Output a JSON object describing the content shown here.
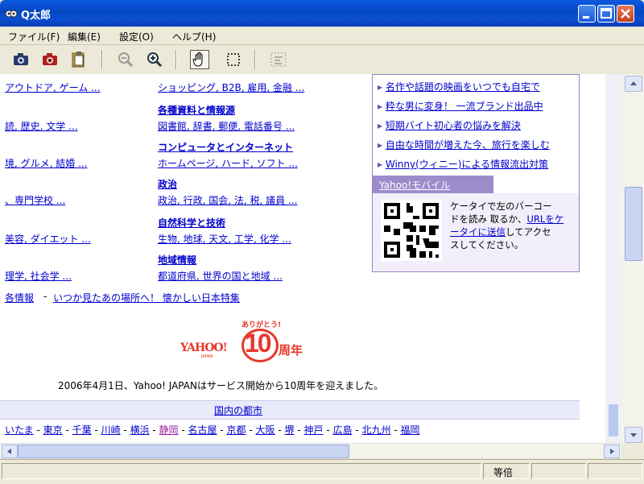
{
  "window": {
    "title": "Q太郎"
  },
  "menu": {
    "file": "ファイル(F)",
    "edit": "編集(E)",
    "settings": "設定(O)",
    "help": "ヘルプ(H)"
  },
  "colors": {
    "link": "#0000cc",
    "panel_header": "#9c8ccc",
    "logo_red": "#e8382c",
    "titlebar": "#0646c2"
  },
  "left_links": {
    "row1": "アウトドア, ゲーム ...",
    "row2": "読, 歴史, 文学 ...",
    "row3": "境, グルメ, 結婚 ...",
    "row4": "、専門学校 ...",
    "row5": "美容, ダイエット ...",
    "row6": "理学, 社会学 ..."
  },
  "directory": {
    "shopping": "ショッピング, B2B, 雇用, 金融 ...",
    "reference_title": "各種資料と情報源",
    "reference_links": "図書館, 辞書, 郵便, 電話番号 ...",
    "computer_title": "コンピュータとインターネット",
    "computer_links": "ホームページ, ハード, ソフト ...",
    "politics_title": "政治",
    "politics_links": "政治, 行政, 国会, 法, 税, 議員 ...",
    "science_title": "自然科学と技術",
    "science_links": "生物, 地球, 天文, 工学, 化学 ...",
    "region_title": "地域情報",
    "region_links": "都道府県, 世界の国と地域 ..."
  },
  "feature": {
    "prefix": "各情報",
    "link": "いつか見たあの場所へ！ 懐かしい日本特集"
  },
  "promo": {
    "items": [
      "名作や話題の映画をいつでも自宅で",
      "粋な男に変身！ 一流ブランド出品中",
      "短期バイト初心者の悩みを解決",
      "自由な時間が増えた今、旅行を楽しむ",
      "Winny(ウィニー)による情報流出対策"
    ],
    "mobile_header": "Yahoo!モバイル",
    "mobile_text_1": "ケータイで左のバーコー",
    "mobile_text_2": "ドを読み 取るか、",
    "mobile_link_1": "URLをケ",
    "mobile_link_2": "ータイに送信",
    "mobile_text_3": "してアクセ",
    "mobile_text_4": "スしてください。"
  },
  "anniversary": {
    "thanks": "ありがとう!",
    "brand": "YAHOO!",
    "brand_sub": "JAPAN",
    "number": "10",
    "suffix": "周年",
    "message": "2006年4月1日、Yahoo! JAPANはサービス開始から10周年を迎えました。"
  },
  "cities": {
    "header": "国内の都市",
    "items": [
      "いたま",
      "東京",
      "千葉",
      "川崎",
      "横浜",
      "静岡",
      "名古屋",
      "京都",
      "大阪",
      "堺",
      "神戸",
      "広島",
      "北九州",
      "福岡"
    ]
  },
  "status": {
    "zoom": "等倍"
  }
}
